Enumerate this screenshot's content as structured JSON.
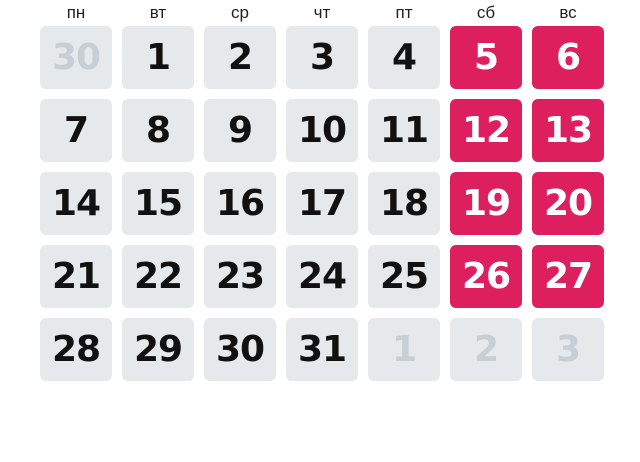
{
  "weekdays": [
    "пн",
    "вт",
    "ср",
    "чт",
    "пт",
    "сб",
    "вс"
  ],
  "days": [
    {
      "label": "30",
      "current": false
    },
    {
      "label": "1",
      "current": true
    },
    {
      "label": "2",
      "current": true
    },
    {
      "label": "3",
      "current": true
    },
    {
      "label": "4",
      "current": true
    },
    {
      "label": "5",
      "current": true
    },
    {
      "label": "6",
      "current": true
    },
    {
      "label": "7",
      "current": true
    },
    {
      "label": "8",
      "current": true
    },
    {
      "label": "9",
      "current": true
    },
    {
      "label": "10",
      "current": true
    },
    {
      "label": "11",
      "current": true
    },
    {
      "label": "12",
      "current": true
    },
    {
      "label": "13",
      "current": true
    },
    {
      "label": "14",
      "current": true
    },
    {
      "label": "15",
      "current": true
    },
    {
      "label": "16",
      "current": true
    },
    {
      "label": "17",
      "current": true
    },
    {
      "label": "18",
      "current": true
    },
    {
      "label": "19",
      "current": true
    },
    {
      "label": "20",
      "current": true
    },
    {
      "label": "21",
      "current": true
    },
    {
      "label": "22",
      "current": true
    },
    {
      "label": "23",
      "current": true
    },
    {
      "label": "24",
      "current": true
    },
    {
      "label": "25",
      "current": true
    },
    {
      "label": "26",
      "current": true
    },
    {
      "label": "27",
      "current": true
    },
    {
      "label": "28",
      "current": true
    },
    {
      "label": "29",
      "current": true
    },
    {
      "label": "30",
      "current": true
    },
    {
      "label": "31",
      "current": true
    },
    {
      "label": "1",
      "current": false
    },
    {
      "label": "2",
      "current": false
    },
    {
      "label": "3",
      "current": false
    }
  ],
  "colors": {
    "weekend_accent": "#dd1f5d",
    "cell_background": "#e5e9ec",
    "other_month_text": "#c5cfd5",
    "day_text": "#111111"
  }
}
